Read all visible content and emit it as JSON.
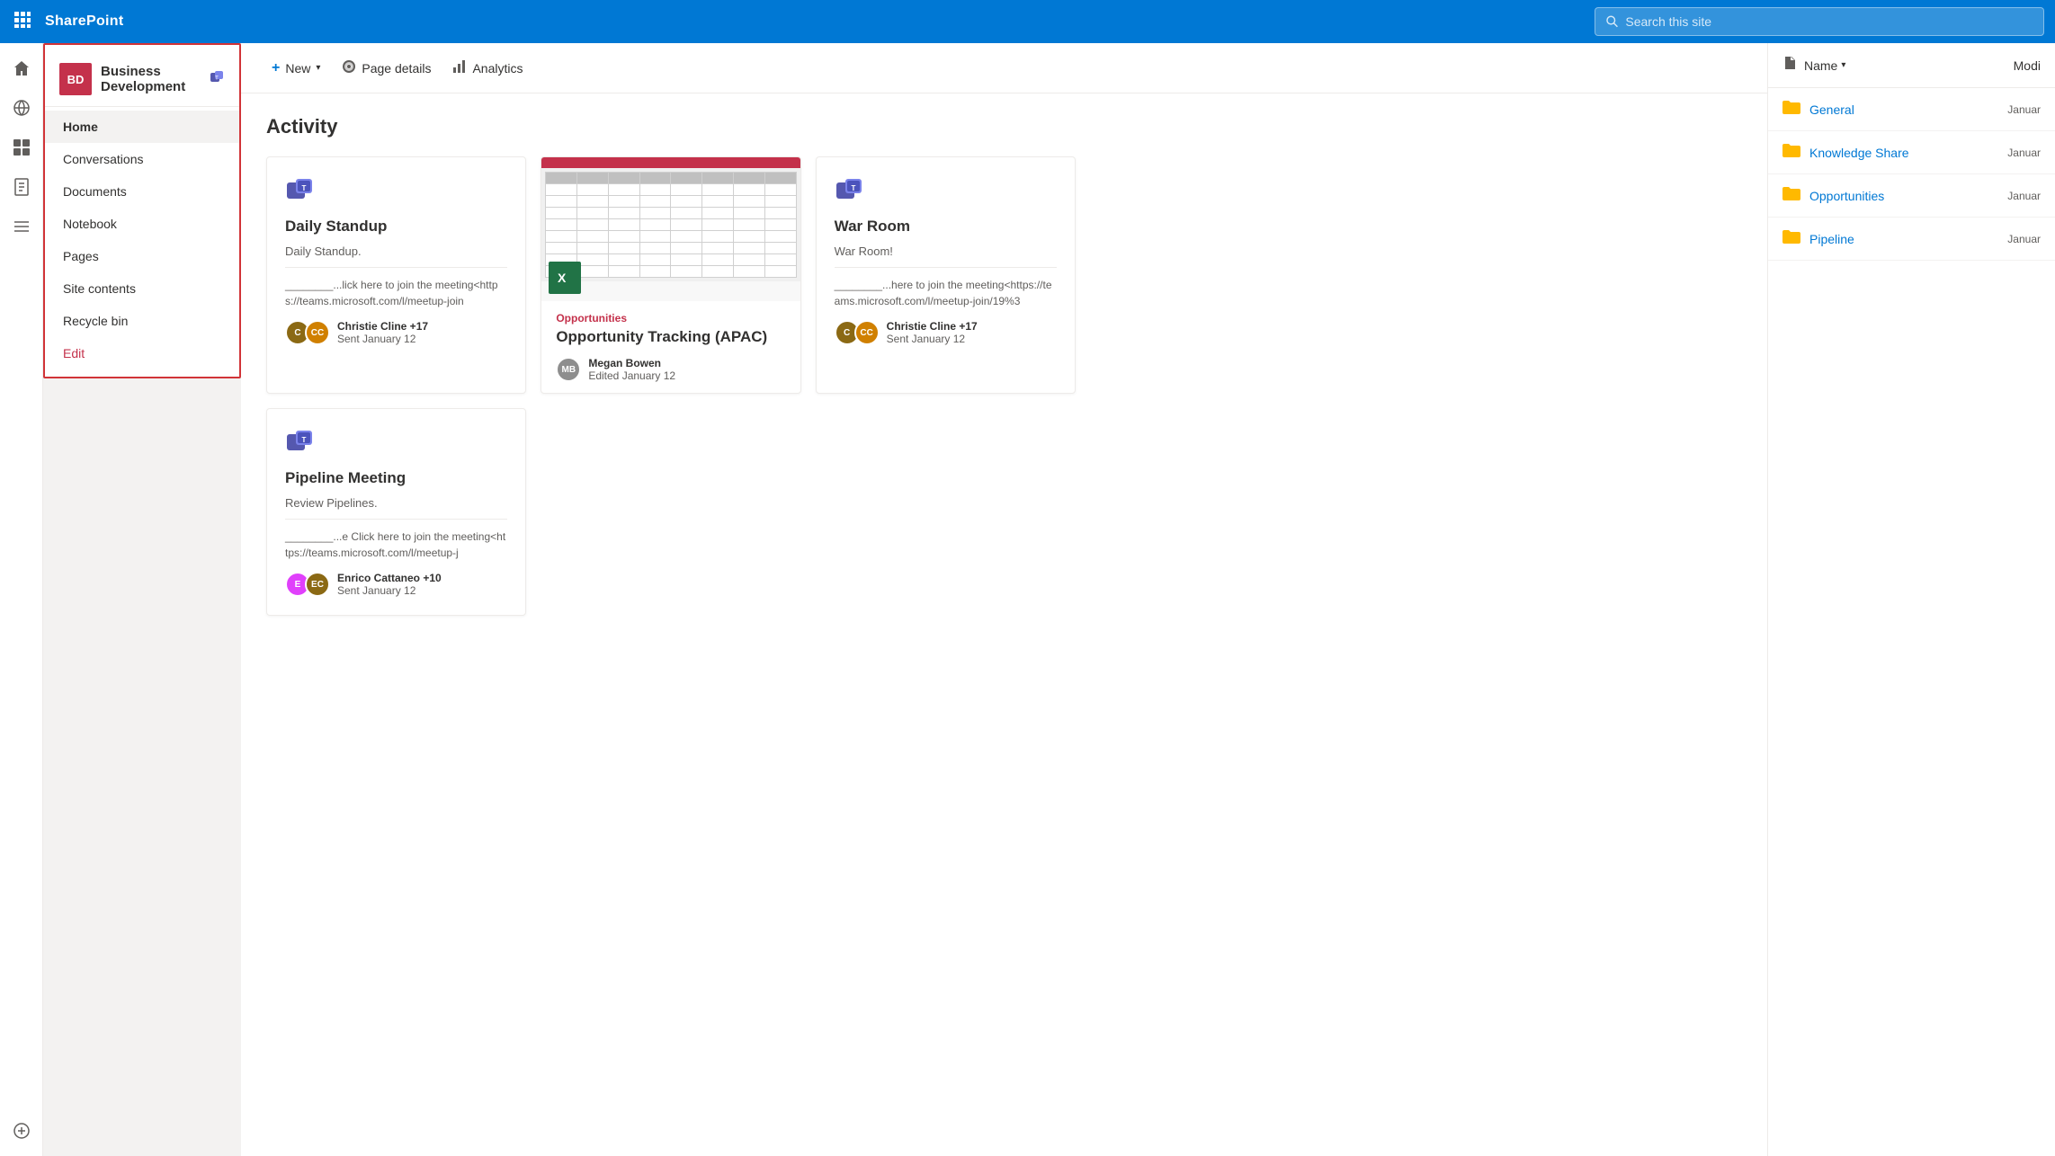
{
  "topbar": {
    "waffle_label": "⊞",
    "logo": "SharePoint",
    "search_placeholder": "Search this site"
  },
  "sidebar": {
    "site_logo_initials": "BD",
    "site_name": "Business Development",
    "nav_items": [
      {
        "id": "home",
        "label": "Home",
        "active": true
      },
      {
        "id": "conversations",
        "label": "Conversations",
        "active": false
      },
      {
        "id": "documents",
        "label": "Documents",
        "active": false
      },
      {
        "id": "notebook",
        "label": "Notebook",
        "active": false
      },
      {
        "id": "pages",
        "label": "Pages",
        "active": false
      },
      {
        "id": "site-contents",
        "label": "Site contents",
        "active": false
      },
      {
        "id": "recycle-bin",
        "label": "Recycle bin",
        "active": false
      },
      {
        "id": "edit",
        "label": "Edit",
        "is_edit": true
      }
    ]
  },
  "toolbar": {
    "new_label": "New",
    "page_details_label": "Page details",
    "analytics_label": "Analytics"
  },
  "main": {
    "activity_title": "Activity",
    "cards": [
      {
        "id": "daily-standup",
        "type": "teams",
        "title": "Daily Standup",
        "description": "Daily Standup.",
        "link_text": "________...lick here to join the meeting<https://teams.microsoft.com/l/meetup-join",
        "author": "Christie Cline +17",
        "date": "Sent January 12",
        "avatar1_initials": "C",
        "avatar2_initials": "CC",
        "avatar1_color": "brown",
        "avatar2_color": "orange"
      },
      {
        "id": "opportunity-tracking",
        "type": "excel",
        "tag": "Opportunities",
        "title": "Opportunity Tracking (APAC)",
        "author": "Megan Bowen",
        "date": "Edited January 12",
        "avatar_initials": "MB",
        "avatar_color": "gray"
      },
      {
        "id": "war-room",
        "type": "teams",
        "title": "War Room",
        "description": "War Room!",
        "link_text": "________...here to join the meeting<https://teams.microsoft.com/l/meetup-join/19%3",
        "author": "Christie Cline +17",
        "date": "Sent January 12",
        "avatar1_initials": "C",
        "avatar2_initials": "CC",
        "avatar1_color": "brown",
        "avatar2_color": "orange"
      },
      {
        "id": "pipeline-meeting",
        "type": "teams",
        "title": "Pipeline Meeting",
        "description": "Review Pipelines.",
        "link_text": "________...e Click here to join the meeting<https://teams.microsoft.com/l/meetup-j",
        "author": "Enrico Cattaneo +10",
        "date": "Sent January 12",
        "avatar1_initials": "E",
        "avatar2_initials": "EC",
        "avatar1_color": "pink",
        "avatar2_color": "brown"
      }
    ]
  },
  "files": {
    "col_name": "Name",
    "col_modified": "Modi",
    "items": [
      {
        "id": "general",
        "name": "General",
        "date": "Januar",
        "type": "folder"
      },
      {
        "id": "knowledge-share",
        "name": "Knowledge Share",
        "date": "Januar",
        "type": "folder"
      },
      {
        "id": "opportunities",
        "name": "Opportunities",
        "date": "Januar",
        "type": "folder"
      },
      {
        "id": "pipeline",
        "name": "Pipeline",
        "date": "Januar",
        "type": "folder"
      }
    ]
  },
  "icons": {
    "waffle": "⊞",
    "search": "🔍",
    "home": "⌂",
    "globe": "🌐",
    "grid": "▦",
    "doc": "📄",
    "list": "☰",
    "add": "⊕",
    "new_plus": "+",
    "chevron_down": "▾",
    "gear": "⚙",
    "chart": "📊",
    "folder": "📁",
    "file_generic": "📄",
    "teams_color": "#5558af"
  }
}
